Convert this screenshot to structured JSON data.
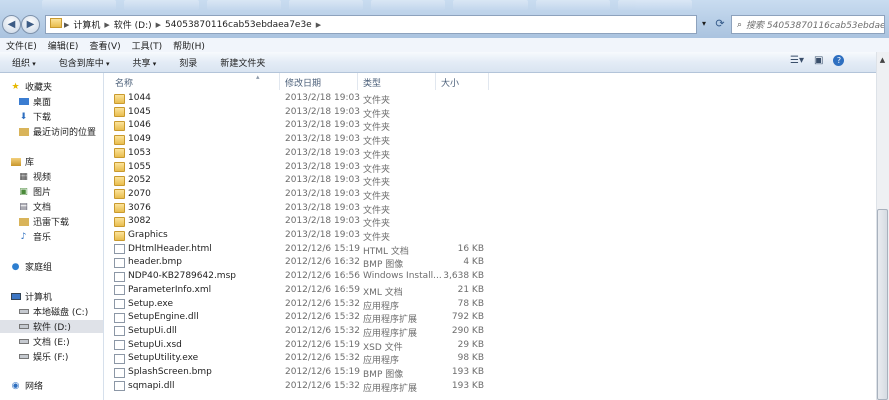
{
  "address": {
    "segments": [
      "计算机",
      "软件 (D:)",
      "54053870116cab53ebdaea7e3e"
    ]
  },
  "search": {
    "placeholder": "搜索 54053870116cab53ebdaea7e3e"
  },
  "menu": [
    "文件(E)",
    "编辑(E)",
    "查看(V)",
    "工具(T)",
    "帮助(H)"
  ],
  "commands": [
    {
      "label": "组织",
      "dropdown": true
    },
    {
      "label": "包含到库中",
      "dropdown": true
    },
    {
      "label": "共享",
      "dropdown": true
    },
    {
      "label": "刻录",
      "dropdown": false
    },
    {
      "label": "新建文件夹",
      "dropdown": false
    }
  ],
  "nav": {
    "favorites": {
      "label": "收藏夹",
      "items": [
        "桌面",
        "下载",
        "最近访问的位置"
      ]
    },
    "libraries": {
      "label": "库",
      "items": [
        "视频",
        "图片",
        "文档",
        "迅雷下载",
        "音乐"
      ]
    },
    "homegroup": "家庭组",
    "computer": {
      "label": "计算机",
      "items": [
        "本地磁盘 (C:)",
        "软件 (D:)",
        "文档 (E:)",
        "娱乐 (F:)"
      ]
    },
    "network": "网络"
  },
  "columns": {
    "name": "名称",
    "date": "修改日期",
    "type": "类型",
    "size": "大小"
  },
  "files": [
    {
      "name": "1044",
      "date": "2013/2/18 19:03",
      "type": "文件夹",
      "size": "",
      "icon": "folder-icon"
    },
    {
      "name": "1045",
      "date": "2013/2/18 19:03",
      "type": "文件夹",
      "size": "",
      "icon": "folder-icon"
    },
    {
      "name": "1046",
      "date": "2013/2/18 19:03",
      "type": "文件夹",
      "size": "",
      "icon": "folder-icon"
    },
    {
      "name": "1049",
      "date": "2013/2/18 19:03",
      "type": "文件夹",
      "size": "",
      "icon": "folder-icon"
    },
    {
      "name": "1053",
      "date": "2013/2/18 19:03",
      "type": "文件夹",
      "size": "",
      "icon": "folder-icon"
    },
    {
      "name": "1055",
      "date": "2013/2/18 19:03",
      "type": "文件夹",
      "size": "",
      "icon": "folder-icon"
    },
    {
      "name": "2052",
      "date": "2013/2/18 19:03",
      "type": "文件夹",
      "size": "",
      "icon": "folder-icon"
    },
    {
      "name": "2070",
      "date": "2013/2/18 19:03",
      "type": "文件夹",
      "size": "",
      "icon": "folder-icon"
    },
    {
      "name": "3076",
      "date": "2013/2/18 19:03",
      "type": "文件夹",
      "size": "",
      "icon": "folder-icon"
    },
    {
      "name": "3082",
      "date": "2013/2/18 19:03",
      "type": "文件夹",
      "size": "",
      "icon": "folder-icon"
    },
    {
      "name": "Graphics",
      "date": "2013/2/18 19:03",
      "type": "文件夹",
      "size": "",
      "icon": "folder-icon"
    },
    {
      "name": "DHtmlHeader.html",
      "date": "2012/12/6 15:19",
      "type": "HTML 文档",
      "size": "16 KB",
      "icon": "html-file-icon"
    },
    {
      "name": "header.bmp",
      "date": "2012/12/6 16:32",
      "type": "BMP 图像",
      "size": "4 KB",
      "icon": "bmp-file-icon"
    },
    {
      "name": "NDP40-KB2789642.msp",
      "date": "2012/12/6 16:56",
      "type": "Windows Install...",
      "size": "3,638 KB",
      "icon": "msp-file-icon"
    },
    {
      "name": "ParameterInfo.xml",
      "date": "2012/12/6 16:59",
      "type": "XML 文档",
      "size": "21 KB",
      "icon": "xml-file-icon"
    },
    {
      "name": "Setup.exe",
      "date": "2012/12/6 15:32",
      "type": "应用程序",
      "size": "78 KB",
      "icon": "exe-file-icon"
    },
    {
      "name": "SetupEngine.dll",
      "date": "2012/12/6 15:32",
      "type": "应用程序扩展",
      "size": "792 KB",
      "icon": "dll-file-icon"
    },
    {
      "name": "SetupUi.dll",
      "date": "2012/12/6 15:32",
      "type": "应用程序扩展",
      "size": "290 KB",
      "icon": "dll-file-icon"
    },
    {
      "name": "SetupUi.xsd",
      "date": "2012/12/6 15:19",
      "type": "XSD 文件",
      "size": "29 KB",
      "icon": "xsd-file-icon"
    },
    {
      "name": "SetupUtility.exe",
      "date": "2012/12/6 15:32",
      "type": "应用程序",
      "size": "98 KB",
      "icon": "exe-file-icon"
    },
    {
      "name": "SplashScreen.bmp",
      "date": "2012/12/6 15:19",
      "type": "BMP 图像",
      "size": "193 KB",
      "icon": "bmp-file-icon"
    },
    {
      "name": "sqmapi.dll",
      "date": "2012/12/6 15:32",
      "type": "应用程序扩展",
      "size": "193 KB",
      "icon": "dll-file-icon"
    }
  ],
  "colors": {
    "selection": "#dfe2e8",
    "folder": "#e9bd4e",
    "toolbar": "#dce6f2"
  }
}
